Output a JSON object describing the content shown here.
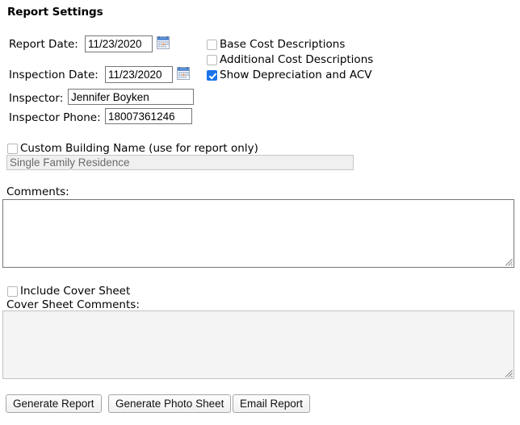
{
  "panel": {
    "title": "Report Settings"
  },
  "fields": {
    "report_date": {
      "label": "Report Date:",
      "value": "11/23/2020",
      "picker_icon": "calendar-icon"
    },
    "inspection_date": {
      "label": "Inspection Date:",
      "value": "11/23/2020",
      "picker_icon": "calendar-icon"
    },
    "inspector": {
      "label": "Inspector:",
      "value": "Jennifer Boyken"
    },
    "inspector_phone": {
      "label": "Inspector Phone:",
      "value": "18007361246"
    }
  },
  "options": [
    {
      "label": "Base Cost Descriptions",
      "checked": false
    },
    {
      "label": "Additional Cost Descriptions",
      "checked": false
    },
    {
      "label": "Show Depreciation and ACV",
      "checked": true
    }
  ],
  "custom_building": {
    "checkbox_label": "Custom Building Name (use for report only)",
    "checked": false,
    "value": "Single Family Residence",
    "disabled": true
  },
  "comments": {
    "label": "Comments:",
    "value": "",
    "disabled": false
  },
  "cover_sheet": {
    "checkbox_label": "Include Cover Sheet",
    "checked": false,
    "comments_label": "Cover Sheet Comments:",
    "comments_value": "",
    "disabled": true
  },
  "buttons": [
    {
      "label": "Generate Report"
    },
    {
      "label": "Generate Photo Sheet"
    },
    {
      "label": "Email Report"
    }
  ],
  "colors": {
    "accent": "#1a73e8",
    "border": "#767676",
    "disabled_bg": "#f0f0f0",
    "text": "#000000"
  }
}
